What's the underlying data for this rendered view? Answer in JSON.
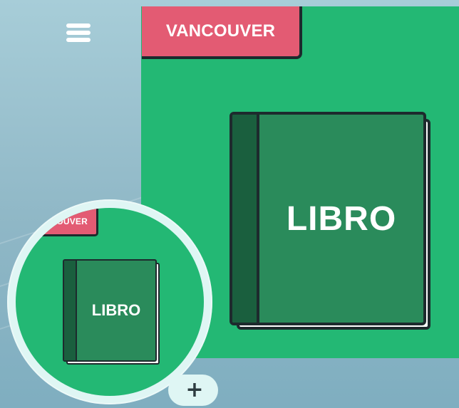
{
  "menu": {
    "icon": "hamburger-menu-icon"
  },
  "main_card": {
    "tag_label": "VANCOUVER",
    "book_title": "LIBRO",
    "colors": {
      "card_bg": "#23b874",
      "tag_bg": "#e35b73",
      "book_cover": "#2a8b5b",
      "book_spine": "#1a5f3e",
      "outline": "#1d2a2d"
    }
  },
  "preview": {
    "tag_label": "COUVER",
    "book_title": "LIBRO"
  },
  "add_button": {
    "label": "+",
    "icon": "plus-icon"
  },
  "colors": {
    "background": "#8fb7c6",
    "circle_bg": "#dff6f4"
  }
}
